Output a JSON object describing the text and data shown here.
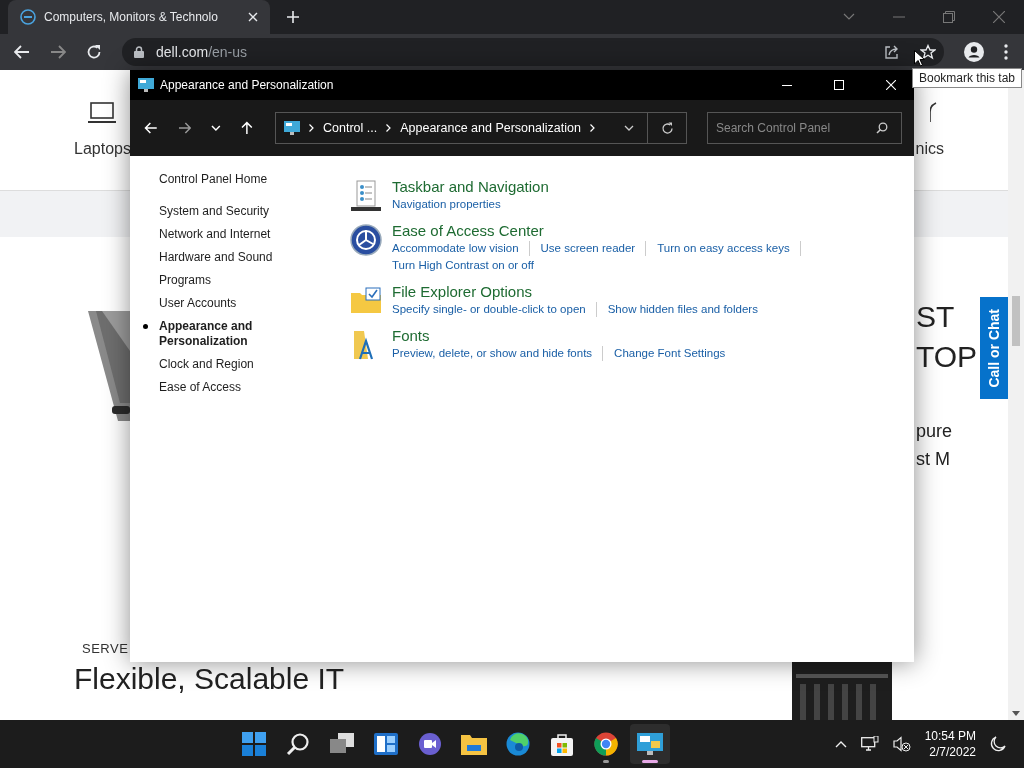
{
  "browser": {
    "tab": {
      "title": "Computers, Monitors & Technolo"
    },
    "url": {
      "domain": "dell.com",
      "path": "/en-us"
    },
    "tooltip": "Bookmark this tab"
  },
  "page": {
    "nav_items": [
      "Laptops",
      "nics"
    ],
    "hero_heading": [
      "ST",
      "TOP"
    ],
    "hero_text": [
      "pure",
      "st M"
    ],
    "section_label": "SERVE",
    "section_title": "Flexible, Scalable IT",
    "chat_button": "Call or Chat"
  },
  "window": {
    "title": "Appearance and Personalization",
    "breadcrumb": [
      "Control ...",
      "Appearance and Personalization"
    ],
    "search": {
      "placeholder": "Search Control Panel"
    },
    "sidebar": {
      "home": "Control Panel Home",
      "items": [
        {
          "label": "System and Security",
          "selected": false
        },
        {
          "label": "Network and Internet",
          "selected": false
        },
        {
          "label": "Hardware and Sound",
          "selected": false
        },
        {
          "label": "Programs",
          "selected": false
        },
        {
          "label": "User Accounts",
          "selected": false
        },
        {
          "label": "Appearance and Personalization",
          "selected": true
        },
        {
          "label": "Clock and Region",
          "selected": false
        },
        {
          "label": "Ease of Access",
          "selected": false
        }
      ]
    },
    "categories": [
      {
        "kind": "taskbar",
        "title": "Taskbar and Navigation",
        "links": [
          "Navigation properties"
        ]
      },
      {
        "kind": "ease",
        "title": "Ease of Access Center",
        "links": [
          "Accommodate low vision",
          "Use screen reader",
          "Turn on easy access keys",
          "Turn High Contrast on or off"
        ]
      },
      {
        "kind": "folder",
        "title": "File Explorer Options",
        "links": [
          "Specify single- or double-click to open",
          "Show hidden files and folders"
        ]
      },
      {
        "kind": "fonts",
        "title": "Fonts",
        "links": [
          "Preview, delete, or show and hide fonts",
          "Change Font Settings"
        ]
      }
    ]
  },
  "taskbar": {
    "apps": [
      {
        "kind": "start",
        "running": false,
        "active": false
      },
      {
        "kind": "search",
        "running": false,
        "active": false
      },
      {
        "kind": "taskview",
        "running": false,
        "active": false
      },
      {
        "kind": "widgets",
        "running": false,
        "active": false
      },
      {
        "kind": "chat",
        "running": false,
        "active": false
      },
      {
        "kind": "explorer",
        "running": false,
        "active": false
      },
      {
        "kind": "edge",
        "running": false,
        "active": false
      },
      {
        "kind": "store",
        "running": false,
        "active": false
      },
      {
        "kind": "chrome",
        "running": true,
        "active": false
      },
      {
        "kind": "controlpanel",
        "running": true,
        "active": true
      }
    ],
    "time": "10:54 PM",
    "date": "2/7/2022"
  }
}
